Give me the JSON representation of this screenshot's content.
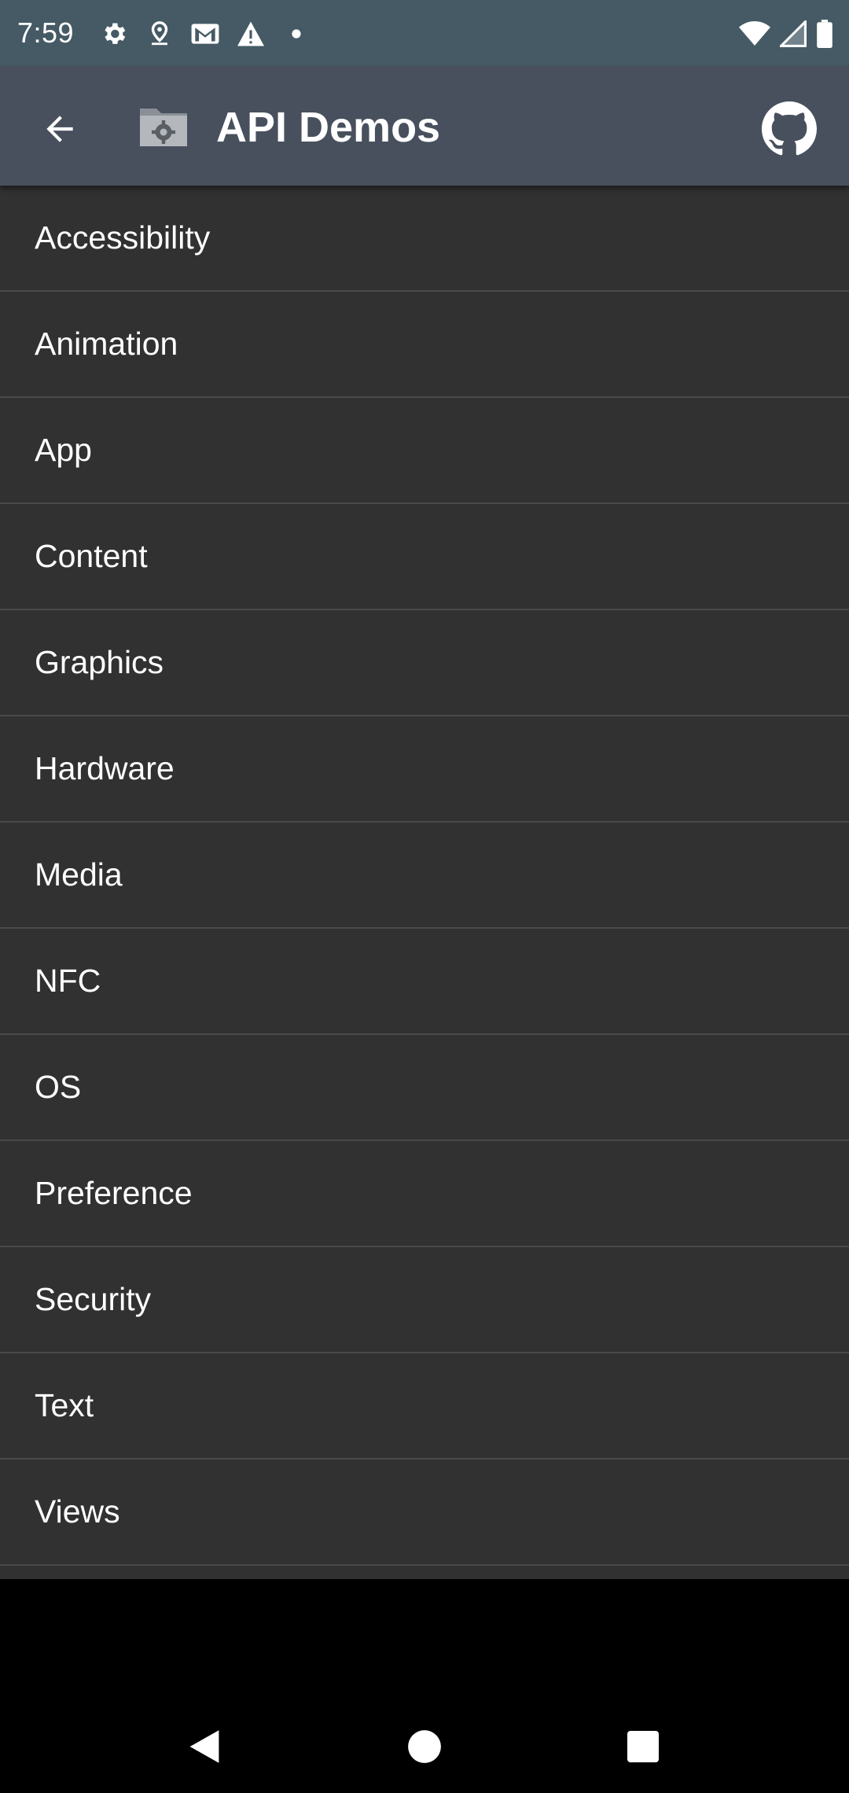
{
  "status_bar": {
    "time": "7:59",
    "left_icons": [
      "settings-icon",
      "location-pin-icon",
      "gmail-icon",
      "warning-icon",
      "notification-dot-icon"
    ],
    "right_icons": [
      "wifi-icon",
      "cellular-signal-icon",
      "battery-icon"
    ]
  },
  "app_bar": {
    "title": "API Demos",
    "back_icon": "arrow-back-icon",
    "app_icon": "folder-gear-icon",
    "action_icon": "github-icon"
  },
  "list": {
    "items": [
      {
        "label": "Accessibility"
      },
      {
        "label": "Animation"
      },
      {
        "label": "App"
      },
      {
        "label": "Content"
      },
      {
        "label": "Graphics"
      },
      {
        "label": "Hardware"
      },
      {
        "label": "Media"
      },
      {
        "label": "NFC"
      },
      {
        "label": "OS"
      },
      {
        "label": "Preference"
      },
      {
        "label": "Security"
      },
      {
        "label": "Text"
      },
      {
        "label": "Views"
      }
    ]
  },
  "nav_bar": {
    "buttons": [
      "back-triangle-icon",
      "home-circle-icon",
      "recents-square-icon"
    ]
  },
  "colors": {
    "status_bar": "#455a64",
    "app_bar": "#48505e",
    "list_background": "#313131",
    "divider": "#4a4a4a",
    "text": "#ffffff"
  }
}
